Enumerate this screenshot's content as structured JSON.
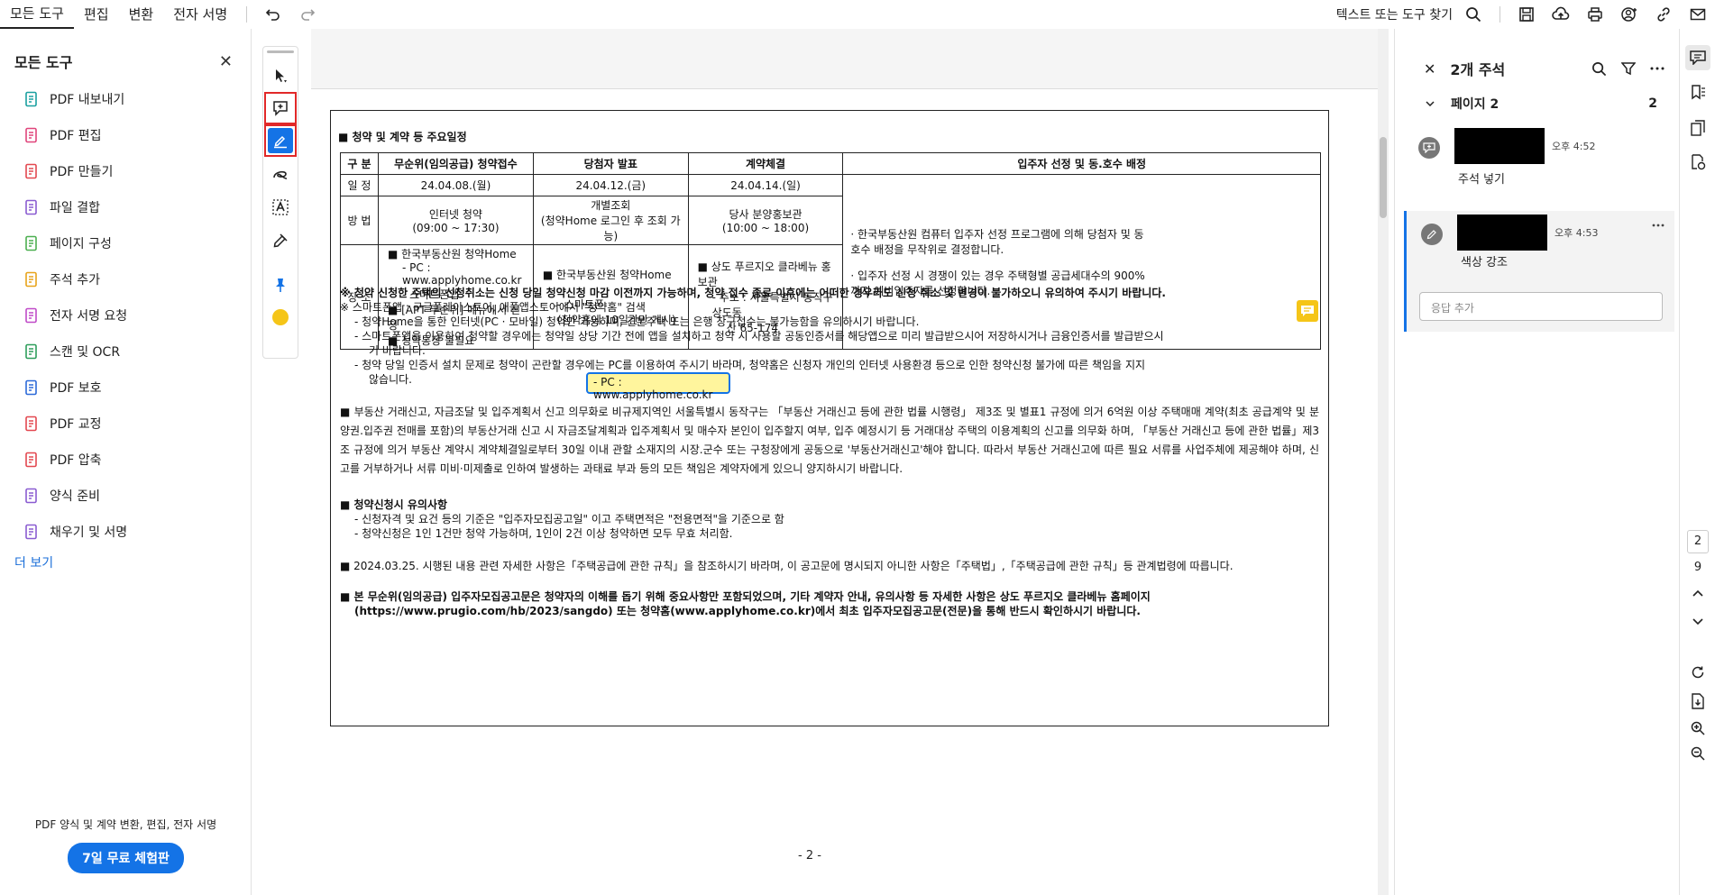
{
  "menu": {
    "all_tools": "모든 도구",
    "edit": "편집",
    "convert": "변환",
    "esign": "전자 서명"
  },
  "topbar": {
    "find": "텍스트 또는 도구 찾기"
  },
  "left_panel": {
    "title": "모든 도구",
    "tools": [
      {
        "label": "PDF 내보내기",
        "color": "#1aa0a0"
      },
      {
        "label": "PDF 편집",
        "color": "#e0457b"
      },
      {
        "label": "PDF 만들기",
        "color": "#e34850"
      },
      {
        "label": "파일 결합",
        "color": "#8a5cd1"
      },
      {
        "label": "페이지 구성",
        "color": "#4caf50"
      },
      {
        "label": "주석 추가",
        "color": "#e8a31a"
      },
      {
        "label": "전자 서명 요청",
        "color": "#c04bc8"
      },
      {
        "label": "스캔 및 OCR",
        "color": "#2e9e5b"
      },
      {
        "label": "PDF 보호",
        "color": "#2d6ad9"
      },
      {
        "label": "PDF 교정",
        "color": "#e34850"
      },
      {
        "label": "PDF 압축",
        "color": "#e34850"
      },
      {
        "label": "양식 준비",
        "color": "#8a5cd1"
      },
      {
        "label": "채우기 및 서명",
        "color": "#8a5cd1"
      }
    ],
    "more": "더 보기",
    "promo_text": "PDF 양식 및 계약 변환, 편집, 전자 서명",
    "promo_button": "7일 무료 체험판"
  },
  "doc": {
    "section1_title": "■ 청약 및 계약 등 주요일정",
    "table": {
      "headers": [
        "구  분",
        "무순위(임의공급) 청약접수",
        "당첨자 발표",
        "계약체결",
        "입주자 선정 및 동.호수 배정"
      ],
      "row_schedule": {
        "label": "일  정",
        "c1": "24.04.08.(월)",
        "c2": "24.04.12.(금)",
        "c3": "24.04.14.(일)"
      },
      "row_method": {
        "label": "방  법",
        "c1a": "인터넷 청약",
        "c1b": "(09:00 ~ 17:30)",
        "c2a": "개별조회",
        "c2b": "(청약Home 로그인 후 조회 가능)",
        "c3a": "당사 분양홍보관",
        "c3b": "(10:00 ~ 18:00)"
      },
      "row_place": {
        "label": "장  소",
        "c1": [
          "■ 한국부동산원 청약Home",
          "- PC : www.applyhome.co.kr",
          "- 스마트폰앱",
          "■ [APT 무순위] 메뉴에서 신청",
          "■ 청약통장 불필요"
        ],
        "c2": [
          "■ 한국부동산원 청약Home",
          "- 스마트폰",
          "(청약홈에 10일간만 게시)"
        ],
        "c3": [
          "■ 상도 푸르지오 클라베뉴 홍보관",
          "- 주소 : 서울특별시 동작구 상도동",
          "산 65-174"
        ]
      },
      "merged": [
        "· 한국부동산원 컴퓨터 입주자 선정 프로그램에 의해 당첨자 및 동호수 배정을 무작위로 결정합니다.",
        "· 입주자 선정 시 경쟁이 있는 경우 주택형별 공급세대수의 900%까지 예비입주자를 선정합니다."
      ]
    },
    "popup_text": "- PC : www.applyhome.co.kr",
    "notes": [
      "※ 청약 신청한 주택의 신청취소는 신청 당일 청약신청 마감 이전까지 가능하며, 청약 접수 종료 이후에는 어떠한 경우라도 신청 취소 및 변경이 불가하오니 유의하여 주시기 바랍니다.",
      "※ 스마트폰앱 : 구글플레이스토어, 애플앱스토어에서 \"청약홈\" 검색",
      "- 청약Home을 통한 인터넷(PC · 모바일) 청약만 가능하며, 견본주택 또는 은행 창구접수는 불가능함을 유의하시기 바랍니다.",
      "- 스마트폰앱을 이용하여 청약할 경우에는 청약일 상당 기간 전에 앱을 설치하고 청약 시 사용할 공동인증서를 해당앱으로 미리 발급받으시어 저장하시거나 금융인증서를 발급받으시",
      "기 바랍니다.",
      "- 청약 당일 인증서 설치 문제로 청약이 곤란할 경우에는 PC를 이용하여 주시기 바라며, 청약홈은 신청자 개인의 인터넷 사용환경 등으로 인한 청약신청 불가에 따른 책임을 지지",
      "않습니다."
    ],
    "para1": "■ 부동산 거래신고, 자금조달 및 입주계획서 신고 의무화로 비규제지역인 서울특별시 동작구는 「부동산 거래신고 등에 관한 법률 시행령」 제3조 및 별표1 규정에 의거 6억원 이상 주택매매 계약(최초 공급계약 및 분양권.입주권 전매를 포함)의 부동산거래 신고 시 자금조달계획과 입주계획서 및 매수자 본인이 입주할지 여부, 입주 예정시기 등 거래대상 주택의 이용계획의 신고를 의무화 하며, 「부동산 거래신고 등에 관한 법률」제3조 규정에 의거 부동산 계약시 계약체결일로부터 30일 이내 관할 소재지의 시장.군수 또는 구청장에게 공동으로 '부동산거래신고'해야 합니다. 따라서 부동산 거래신고에 따른 필요 서류를 사업주체에 제공해야 하며, 신고를 거부하거나 서류 미비·미제출로 인하여 발생하는 과태료 부과 등의 모든 책임은 계약자에게 있으니 양지하시기 바랍니다.",
    "section2_title": "■ 청약신청시 유의사항",
    "section2_items": [
      "- 신청자격 및 요건 등의 기준은 \"입주자모집공고일\" 이고 주택면적은 \"전용면적\"을 기준으로 함",
      "- 청약신청은 1인 1건만 청약 가능하며, 1인이 2건 이상 청약하면 모두 무효 처리함."
    ],
    "para2": "■ 2024.03.25. 시행된 내용 관련 자세한 사항은「주택공급에 관한 규칙」을 참조하시기 바라며, 이 공고문에 명시되지 아니한 사항은「주택법」,「주택공급에 관한 규칙」등 관계법령에 따릅니다.",
    "para3a": "■ 본 무순위(임의공급) 입주자모집공고문은 청약자의 이해를 돕기 위해 중요사항만 포함되었으며, 기타 계약자 안내, 유의사항 등 자세한 사항은 상도 푸르지오 클라베뉴 홈페이지",
    "para3b": "(https://www.prugio.com/hb/2023/sangdo) 또는 청약홈(www.applyhome.co.kr)에서 최초 입주자모집공고문(전문)을 통해 반드시 확인하시기 바랍니다.",
    "page_footer": "- 2 -"
  },
  "comments_panel": {
    "title": "2개 주석",
    "page_group": "페이지 2",
    "page_count": "2",
    "comments": [
      {
        "time": "오후 4:52",
        "text": "주석 넣기"
      },
      {
        "time": "오후 4:53",
        "text": "색상 강조"
      }
    ],
    "reply_placeholder": "응답 추가"
  },
  "rail": {
    "page_current": "2",
    "page_total": "9"
  }
}
